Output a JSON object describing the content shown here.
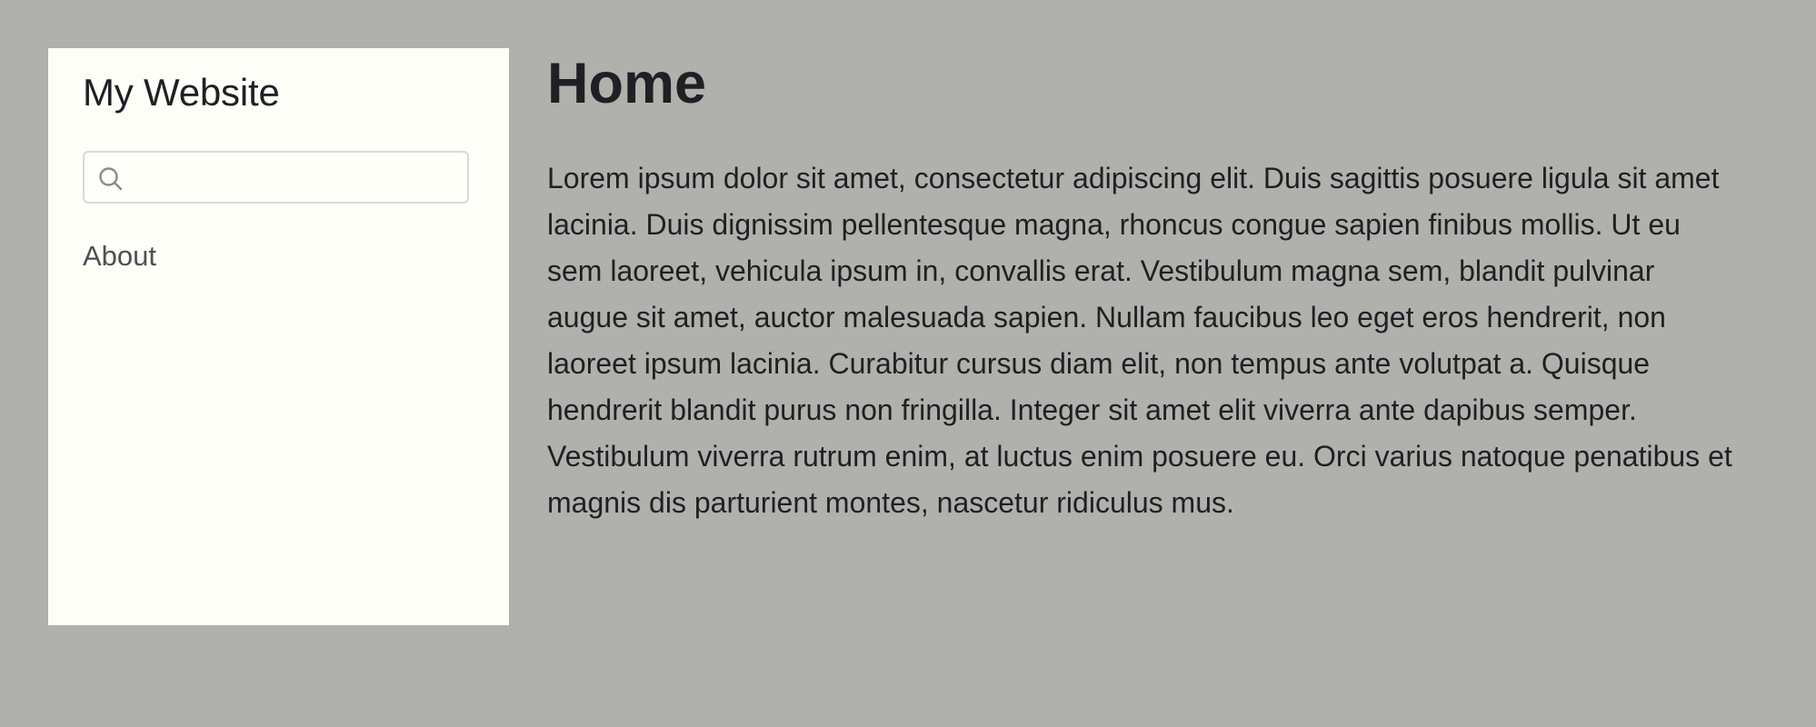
{
  "sidebar": {
    "site_title": "My Website",
    "search": {
      "value": "",
      "placeholder": "",
      "icon": "search-icon"
    },
    "nav_items": [
      {
        "label": "About"
      }
    ]
  },
  "main": {
    "title": "Home",
    "body": "Lorem ipsum dolor sit amet, consectetur adipiscing elit. Duis sagittis posuere ligula sit amet lacinia. Duis dignissim pellentesque magna, rhoncus congue sapien finibus mollis. Ut eu sem laoreet, vehicula ipsum in, convallis erat. Vestibulum magna sem, blandit pulvinar augue sit amet, auctor malesuada sapien. Nullam faucibus leo eget eros hendrerit, non laoreet ipsum lacinia. Curabitur cursus diam elit, non tempus ante volutpat a. Quisque hendrerit blandit purus non fringilla. Integer sit amet elit viverra ante dapibus semper. Vestibulum viverra rutrum enim, at luctus enim posuere eu. Orci varius natoque penatibus et magnis dis parturient montes, nascetur ridiculus mus."
  },
  "colors": {
    "page_background": "#b0b1ac",
    "sidebar_background": "#fefff9",
    "text": "#1f2024",
    "nav_text": "#4e4f52",
    "input_border": "#d8d8dc"
  }
}
